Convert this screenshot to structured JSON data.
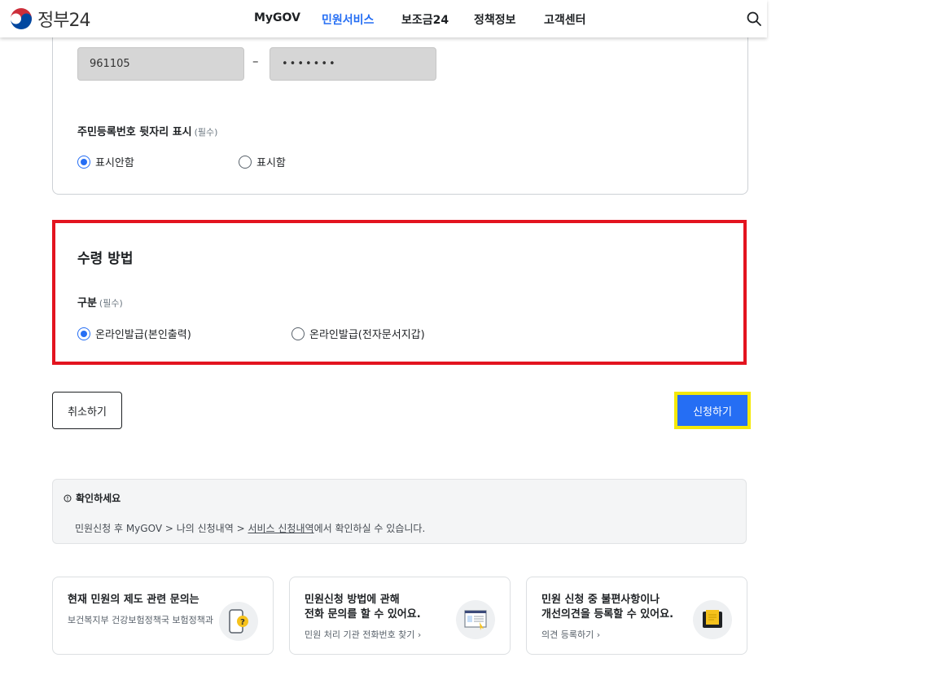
{
  "header": {
    "logo_text": "정부24",
    "nav": [
      "MyGOV",
      "민원서비스",
      "보조금24",
      "정책정보",
      "고객센터"
    ],
    "active_nav": "민원서비스"
  },
  "id_section": {
    "rrn_front": "961105",
    "rrn_separator": "–",
    "rrn_back_masked": "•••••••",
    "display_label": "주민등록번호 뒷자리 표시",
    "required": "(필수)",
    "options": [
      "표시안함",
      "표시함"
    ],
    "selected": "표시안함"
  },
  "receipt": {
    "title": "수령 방법",
    "label": "구분",
    "required": "(필수)",
    "options": [
      "온라인발급(본인출력)",
      "온라인발급(전자문서지갑)"
    ],
    "selected": "온라인발급(본인출력)"
  },
  "buttons": {
    "cancel": "취소하기",
    "apply": "신청하기"
  },
  "notice": {
    "title": "확인하세요",
    "text_before": "민원신청 후 MyGOV > 나의 신청내역 > ",
    "link": "서비스 신청내역",
    "text_after": "에서 확인하실 수 있습니다."
  },
  "cards": [
    {
      "title": [
        "현재 민원의 제도 관련 문의는"
      ],
      "sub": "보건복지부 건강보험정책국 보험정책과",
      "icon": "phone-question-icon"
    },
    {
      "title": [
        "민원신청 방법에 관해",
        "전화 문의를 할 수 있어요."
      ],
      "sub": "민원 처리 기관 전화번호 찾기 ›",
      "icon": "document-click-icon"
    },
    {
      "title": [
        "민원 신청 중 불편사항이나",
        "개선의견을 등록할 수 있어요."
      ],
      "sub": "의견 등록하기 ›",
      "icon": "notepad-icon"
    }
  ],
  "colors": {
    "primary": "#256ef4",
    "highlight_red": "#e3141f",
    "highlight_yellow": "#f4e80a"
  }
}
